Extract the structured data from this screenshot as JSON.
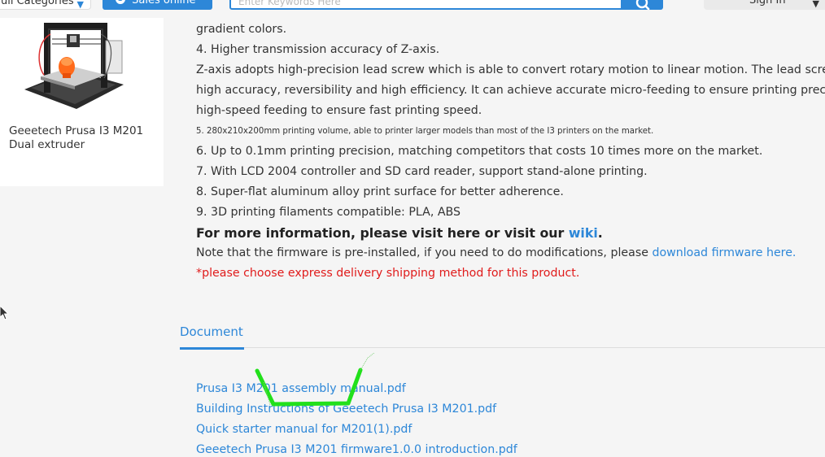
{
  "header": {
    "category_label": "ull Categories",
    "sales_label": "Sales online",
    "search_placeholder": "Enter Keywords Here",
    "signin_label": "Sign In"
  },
  "product": {
    "name": "Geeetech Prusa I3 M201 Dual extruder"
  },
  "description": {
    "lines": [
      "gradient colors.",
      "4. Higher transmission accuracy of Z-axis.",
      "Z-axis adopts high-precision lead screw which is able to convert rotary motion to linear motion. The lead screw has",
      "high accuracy, reversibility and high efficiency. It can achieve accurate micro-feeding to ensure printing precision and",
      "high-speed feeding to ensure fast printing speed.",
      "5. 280x210x200mm printing volume, able to printer larger models than most of the I3 printers on the market.",
      "6. Up to 0.1mm printing precision, matching competitors that costs 10 times more on the market.",
      "7. With LCD 2004 controller and SD card reader, support stand-alone printing.",
      "8. Super-flat aluminum alloy print surface for better adherence.",
      "9. 3D printing filaments compatible: PLA, ABS"
    ],
    "more_info_text": "For more information, please visit here or visit our",
    "wiki_link": "wiki",
    "more_info_end": ".",
    "firmware_text": "Note that the firmware is pre-installed, if you need to do modifications, please",
    "firmware_link": "download firmware here.",
    "shipping_notice": "*please choose express delivery shipping method for this product."
  },
  "documents": {
    "tab_label": "Document",
    "files": [
      "Prusa I3 M201 assembly manual.pdf",
      "Building Instructions of Geeetech Prusa I3 M201.pdf",
      "Quick starter manual for M201(1).pdf",
      "Geeetech Prusa I3 M201 firmware1.0.0 introduction.pdf"
    ]
  },
  "colors": {
    "accent": "#2d87d8",
    "warning": "#e01b1b",
    "annotation": "#22e01b"
  },
  "icons": [
    "chevron-down-icon",
    "skype-icon",
    "search-icon",
    "cursor-icon"
  ]
}
